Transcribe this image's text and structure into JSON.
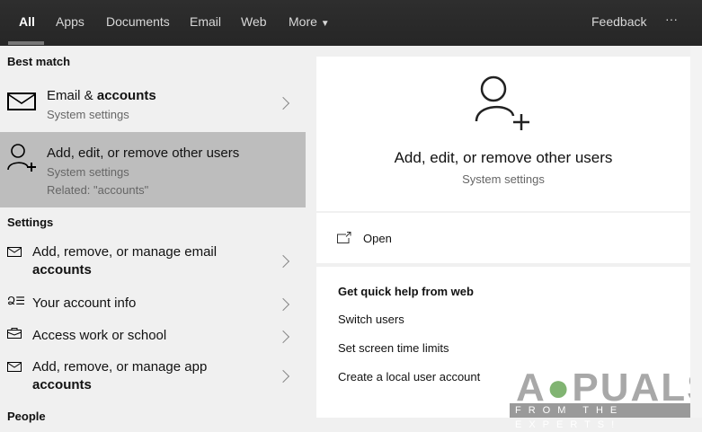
{
  "tabs": [
    "All",
    "Apps",
    "Documents",
    "Email",
    "Web",
    "More"
  ],
  "feedback": "Feedback",
  "more_menu": "···",
  "best_match_heading": "Best match",
  "best_match": [
    {
      "title_pre": "Email & ",
      "title_bold": "accounts",
      "subtitle": "System settings",
      "icon": "mail-icon"
    },
    {
      "title": "Add, edit, or remove other users",
      "subtitle": "System settings",
      "related": "Related: \"accounts\"",
      "icon": "user-add-icon"
    }
  ],
  "settings_heading": "Settings",
  "settings": [
    {
      "line1": "Add, remove, or manage email",
      "line2": "accounts",
      "icon": "mail-icon"
    },
    {
      "line1": "Your account info",
      "icon": "account-info-icon"
    },
    {
      "line1": "Access work or school",
      "icon": "briefcase-icon"
    },
    {
      "line1": "Add, remove, or manage app",
      "line2": "accounts",
      "icon": "mail-icon"
    }
  ],
  "people_heading": "People",
  "detail": {
    "title": "Add, edit, or remove other users",
    "subtitle": "System settings",
    "open": "Open",
    "help_heading": "Get quick help from web",
    "help_links": [
      "Switch users",
      "Set screen time limits",
      "Create a local user account"
    ]
  },
  "watermark": {
    "brand": "APPUALS",
    "tagline": "FROM THE EXPERTS!"
  }
}
